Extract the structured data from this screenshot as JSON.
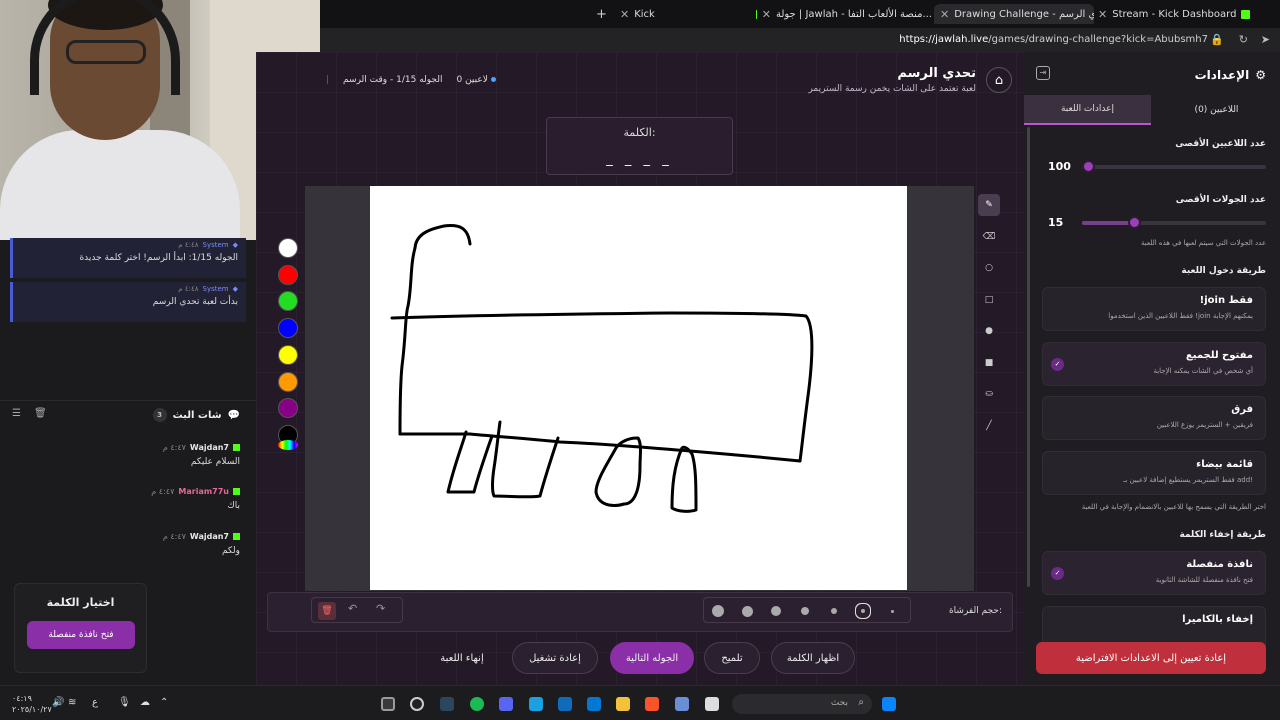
{
  "browser": {
    "tabs": [
      {
        "label": "Kick",
        "icon": "kick-icon"
      },
      {
        "label": "جولة | Jawlah - منصة الألعاب التفا...",
        "icon": "jawlah-icon"
      },
      {
        "label": "Drawing Challenge - تحدي الرسم |",
        "icon": "jawlah-icon"
      },
      {
        "label": "Stream - Kick Dashboard",
        "icon": "kick-icon"
      }
    ],
    "url_host": "https://jawlah.live",
    "url_path": "/games/drawing-challenge?kick=Abubsmh7"
  },
  "chat": {
    "system_messages": [
      {
        "user": "System",
        "time": "٤:٤٨ م",
        "text": "الجوله 1/15: ابدأ الرسم! اختر كلمة جديدة"
      },
      {
        "user": "System",
        "time": "٤:٤٨ م",
        "text": "بدأت لعبة تحدي الرسم"
      }
    ],
    "title": "شات البث",
    "count": "3",
    "messages": [
      {
        "user": "Wajdan7",
        "time": "٤:٤٧ م",
        "text": "السلام عليكم",
        "color": "#e8e8e8"
      },
      {
        "user": "Mariam77u",
        "time": "٤:٤٧ م",
        "text": "باك",
        "color": "#e06a9a"
      },
      {
        "user": "Wajdan7",
        "time": "٤:٤٧ م",
        "text": "ولكم",
        "color": "#e8e8e8"
      }
    ]
  },
  "word_choice": {
    "title": "اختيار الكلمة",
    "button": "فتح نافذة منفصلة"
  },
  "game": {
    "title": "تحدي الرسم",
    "subtitle": "لعبة تعتمد على الشات يخمن رسمة الستريمر",
    "players": "0 لاعبين",
    "round": "الجوله 1/15 - وقت الرسم",
    "word_label": "الكلمة:",
    "word_mask": "_ _ _ _",
    "brush_label": "حجم الفرشاة:",
    "palette": [
      "#ffffff",
      "#ff0000",
      "#22dd22",
      "#0000ff",
      "#ffff00",
      "#ff9900",
      "#880088",
      "#000000"
    ],
    "actions": {
      "show_word": "اظهار الكلمة",
      "hint": "تلميح",
      "next_round": "الجوله التالية",
      "restart": "إعادة تشغيل",
      "end_game": "إنهاء اللعبة"
    }
  },
  "settings": {
    "title": "الإعدادات",
    "tab_players": "اللاعبين (0)",
    "tab_game": "إعدادات اللعبة",
    "max_players_label": "عدد اللاعبين الأقصى",
    "max_players_value": "100",
    "max_players_fraction": 0.03,
    "max_rounds_label": "عدد الجولات الأقصى",
    "max_rounds_value": "15",
    "max_rounds_fraction": 0.28,
    "max_rounds_hint": "عدد الجولات التي سيتم لعبها في هذه اللعبة",
    "join_method_label": "طريقة دخول اللعبة",
    "join_options": [
      {
        "title": "!join فقط",
        "desc": "فقط اللاعبين الذين استخدموا !join يمكنهم الإجابة",
        "selected": false
      },
      {
        "title": "مفتوح للجميع",
        "desc": "أي شخص في الشات يمكنه الإجابة",
        "selected": true
      },
      {
        "title": "فرق",
        "desc": "فريقين + الستريمر يوزع اللاعبين",
        "selected": false
      },
      {
        "title": "قائمة بيضاء",
        "desc": "فقط الستريمر يستطيع إضافة لاعبين بـ add!",
        "selected": false
      }
    ],
    "join_hint": "اختر الطريقة التي يسمح بها للاعبين بالانضمام والإجابة في اللعبة",
    "hide_method_label": "طريقة إخفاء الكلمة",
    "hide_options": [
      {
        "title": "نافذة منفصلة",
        "desc": "فتح نافذة منفصلة للشاشة الثانوية",
        "selected": true
      },
      {
        "title": "إخفاء بالكاميرا",
        "desc": "",
        "selected": false
      }
    ],
    "reset_button": "إعادة تعيين إلى الاعدادات الافتراضية"
  },
  "taskbar": {
    "search_placeholder": "بحث",
    "time": "٠٤:١٩",
    "date": "٢٠٢٥/١٠/٢٧"
  }
}
